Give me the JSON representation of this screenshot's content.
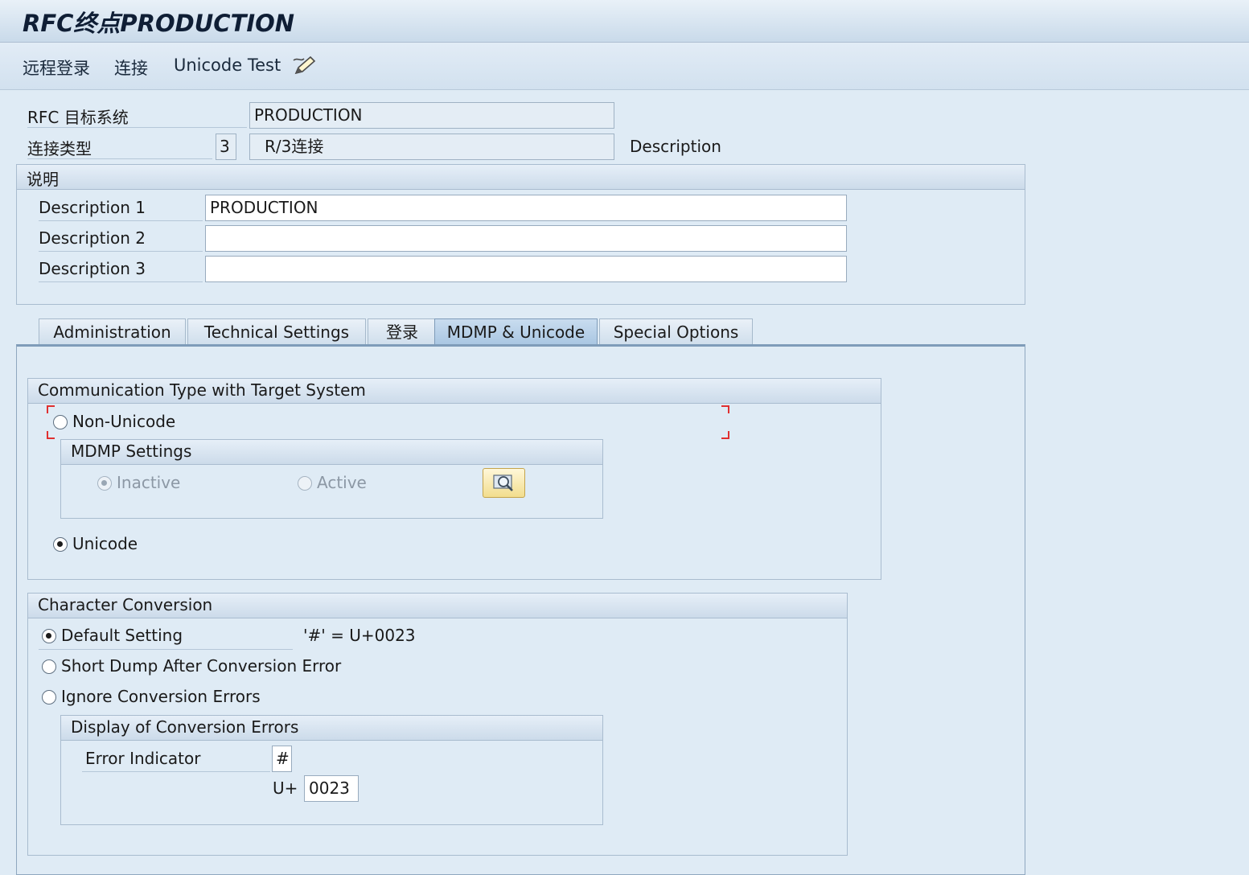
{
  "window": {
    "title": "RFC终点PRODUCTION"
  },
  "toolbar": {
    "remote_login": "远程登录",
    "connection": "连接",
    "unicode_test": "Unicode Test",
    "icon": "edit-pencil-icon"
  },
  "header": {
    "rfc_dest_label": "RFC 目标系统",
    "rfc_dest_value": "PRODUCTION",
    "conn_type_label": "连接类型",
    "conn_type_code": "3",
    "conn_type_text": "R/3连接",
    "description_label": "Description"
  },
  "desc_group": {
    "title": "说明",
    "rows": [
      {
        "label": "Description 1",
        "value": "PRODUCTION"
      },
      {
        "label": "Description 2",
        "value": ""
      },
      {
        "label": "Description 3",
        "value": ""
      }
    ]
  },
  "tabs": [
    {
      "label": "Administration"
    },
    {
      "label": "Technical Settings"
    },
    {
      "label": "登录"
    },
    {
      "label": "MDMP & Unicode",
      "active": true
    },
    {
      "label": "Special Options"
    }
  ],
  "comm_group": {
    "title": "Communication Type with Target System",
    "non_unicode": "Non-Unicode",
    "mdmp": {
      "title": "MDMP Settings",
      "inactive": "Inactive",
      "active": "Active",
      "button_icon": "search-icon"
    },
    "unicode": "Unicode",
    "selected": "Unicode"
  },
  "char_group": {
    "title": "Character Conversion",
    "default_setting": "Default Setting",
    "default_note": "'#' = U+0023",
    "short_dump": "Short Dump After Conversion Error",
    "ignore": "Ignore Conversion Errors",
    "selected": "Default Setting",
    "display": {
      "title": "Display of Conversion Errors",
      "error_indicator_label": "Error Indicator",
      "error_indicator_value": "#",
      "u_prefix": "U+",
      "u_value": "0023"
    }
  }
}
